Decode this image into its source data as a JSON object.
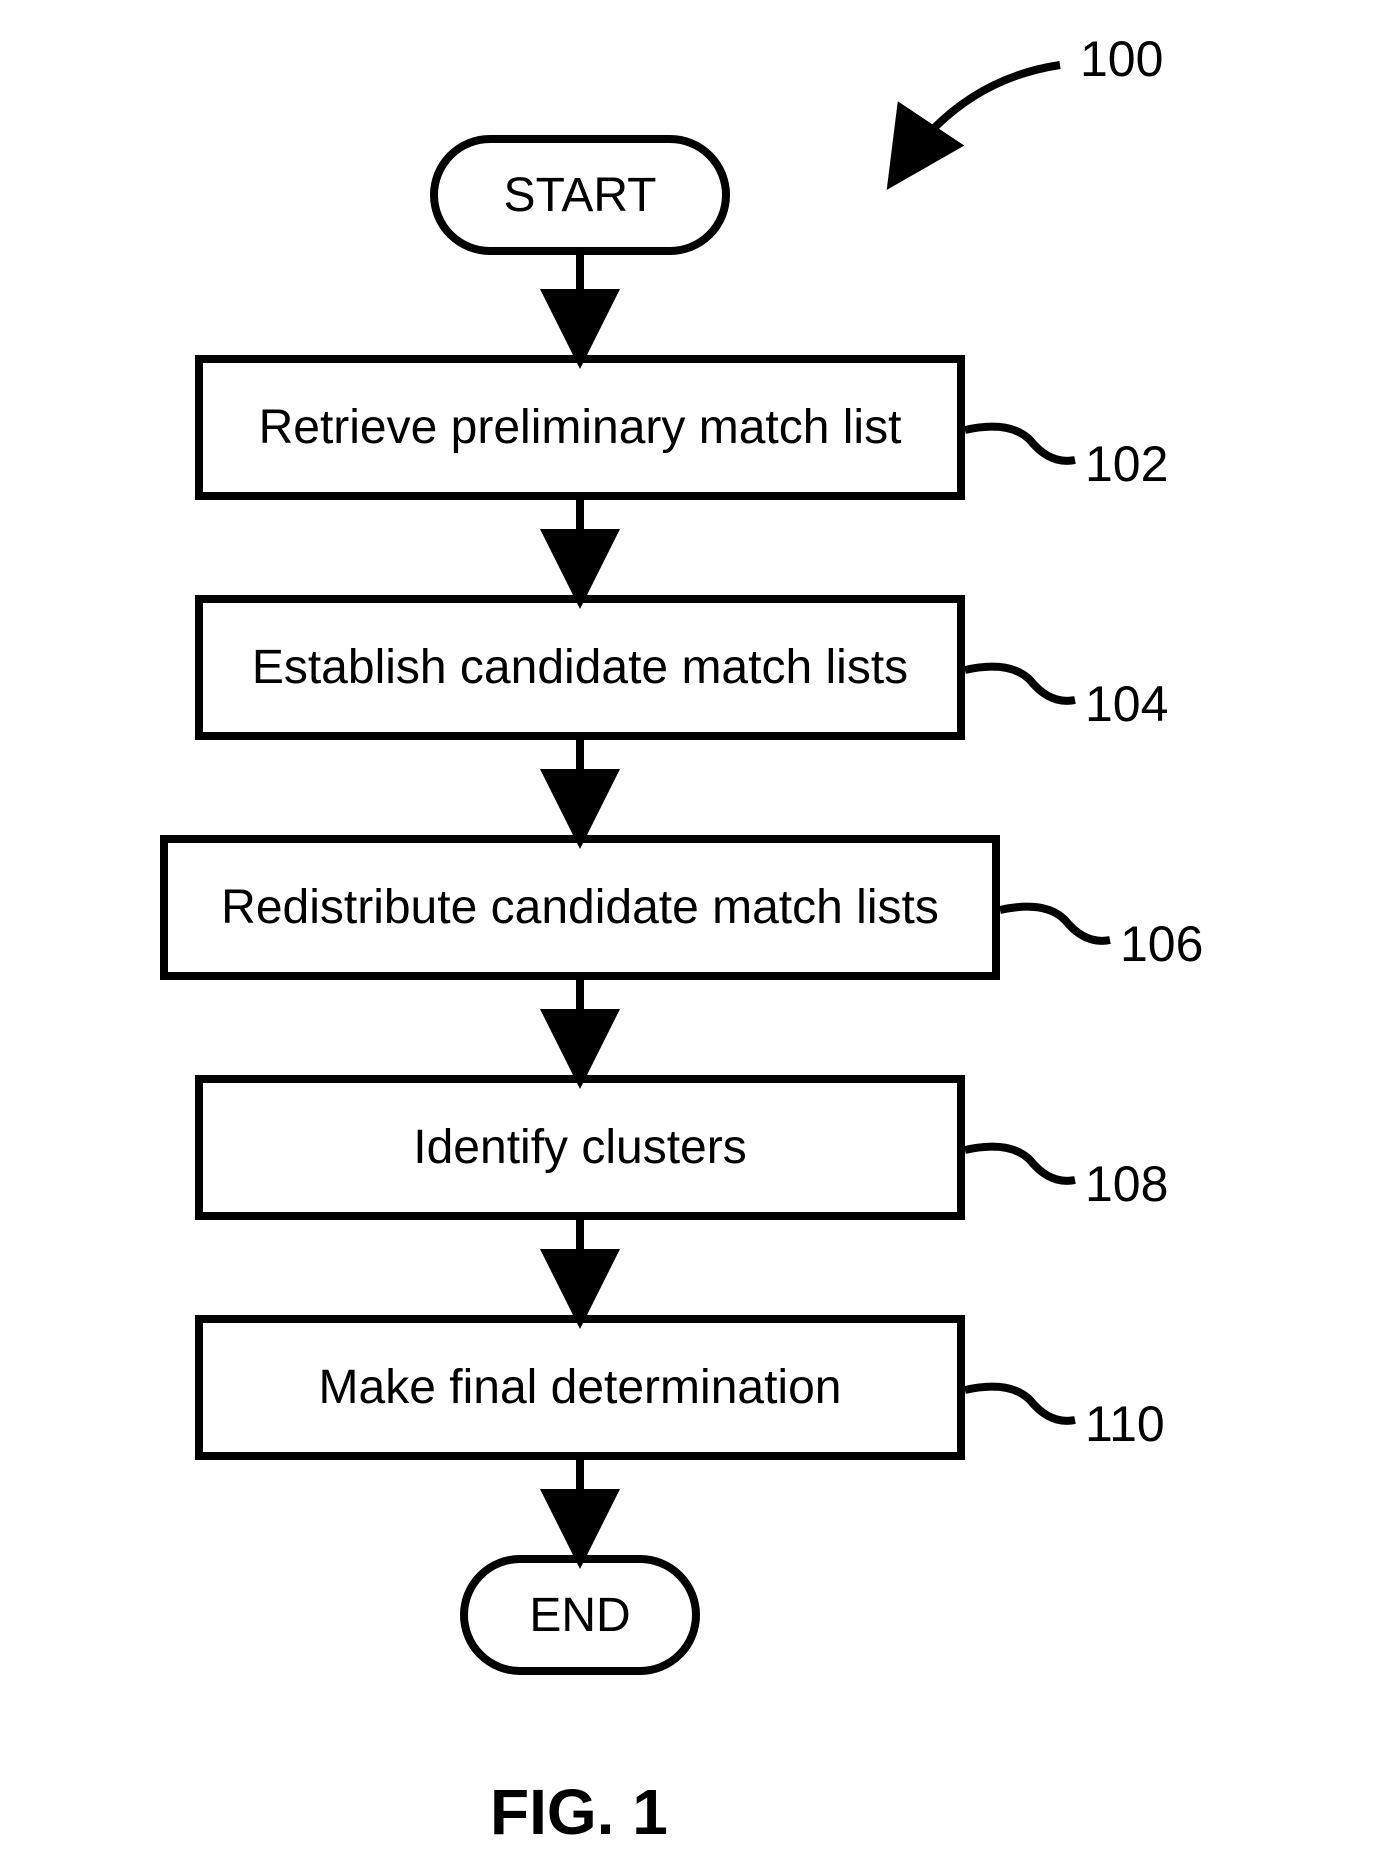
{
  "figure": {
    "caption": "FIG. 1",
    "ref_top": "100",
    "terminals": {
      "start": "START",
      "end": "END"
    },
    "steps": [
      {
        "text": "Retrieve preliminary match list",
        "ref": "102"
      },
      {
        "text": "Establish candidate match lists",
        "ref": "104"
      },
      {
        "text": "Redistribute candidate match lists",
        "ref": "106"
      },
      {
        "text": "Identify clusters",
        "ref": "108"
      },
      {
        "text": "Make final determination",
        "ref": "110"
      }
    ]
  }
}
